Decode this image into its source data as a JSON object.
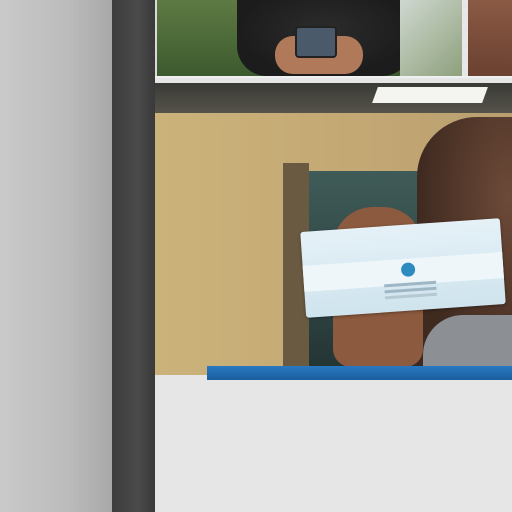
{
  "layout": {
    "left_panel_color": "#bcbcbc",
    "divider_color": "#444444",
    "content_background": "#e6e6e6",
    "accent_bar_color": "#1f6aad"
  },
  "photos": {
    "top": {
      "icon": "image-icon"
    },
    "main": {
      "icon": "image-icon"
    }
  }
}
